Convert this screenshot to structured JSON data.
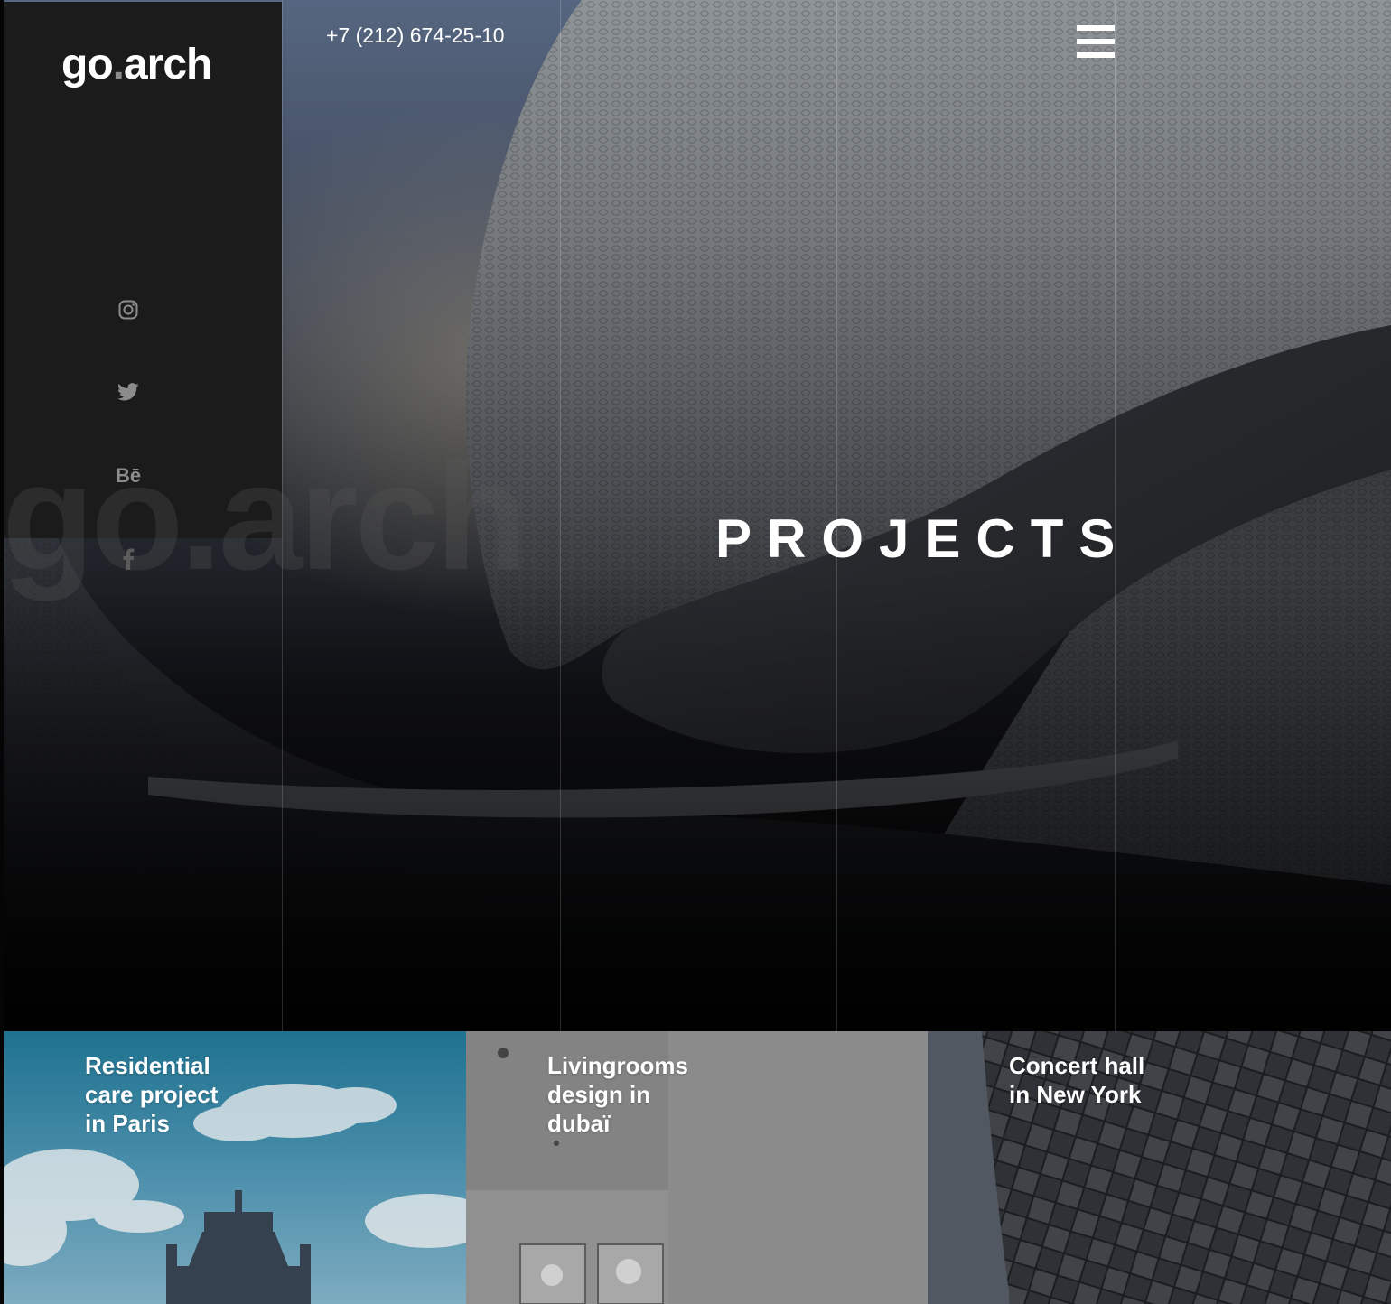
{
  "brand": {
    "logo_main": "go",
    "logo_dot": ".",
    "logo_tail": "arch",
    "watermark": "go.arch"
  },
  "header": {
    "phone": "+7 (212) 674-25-10"
  },
  "hero": {
    "title": "PROJECTS"
  },
  "social": [
    {
      "icon": "instagram-icon"
    },
    {
      "icon": "twitter-icon"
    },
    {
      "icon": "behance-icon",
      "label": "Bē"
    },
    {
      "icon": "facebook-icon"
    }
  ],
  "projects": [
    {
      "title_lines": [
        "Residential",
        "care project",
        "in Paris"
      ]
    },
    {
      "title_lines": [
        "Livingrooms",
        "design in",
        "dubaï"
      ]
    },
    {
      "title_lines": [
        "Concert hall",
        "in New York"
      ]
    }
  ],
  "colors": {
    "sidebar": "#1b1b1b",
    "text": "#ffffff",
    "logo_dot": "#8a8a8a",
    "social_icons": "#8c8c8c"
  }
}
